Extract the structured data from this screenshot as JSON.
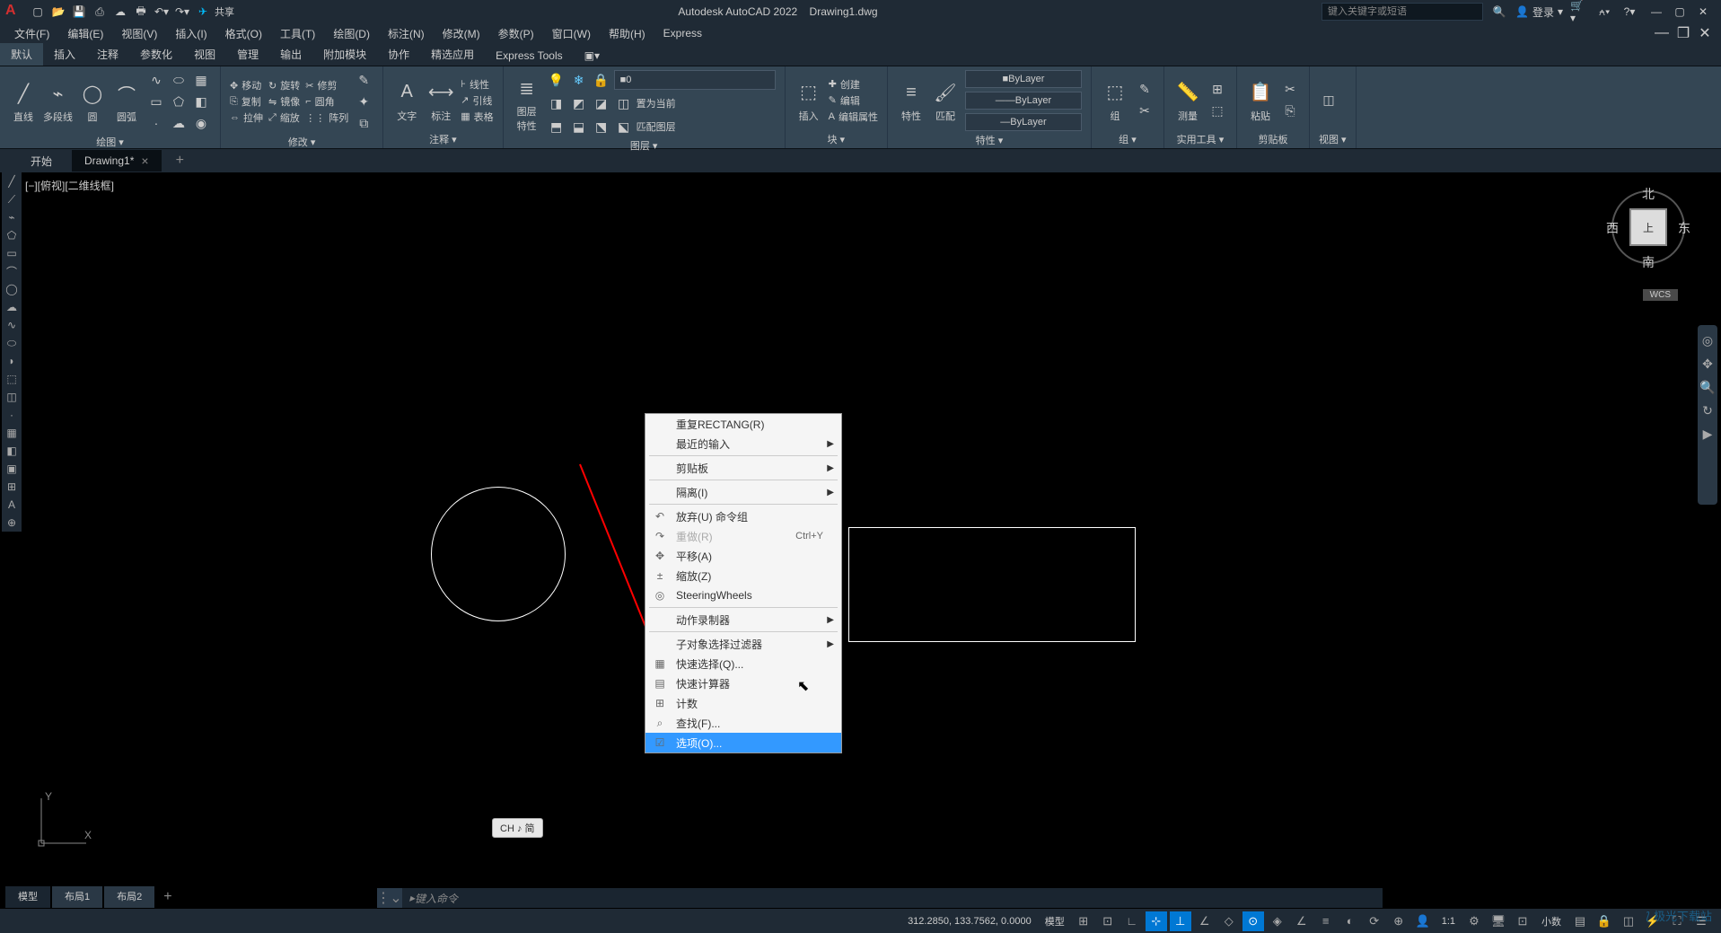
{
  "app": {
    "title_left": "Autodesk AutoCAD 2022",
    "title_right": "Drawing1.dwg",
    "share": "共享",
    "search_placeholder": "键入关键字或短语",
    "login": "登录"
  },
  "menubar": [
    "文件(F)",
    "编辑(E)",
    "视图(V)",
    "插入(I)",
    "格式(O)",
    "工具(T)",
    "绘图(D)",
    "标注(N)",
    "修改(M)",
    "参数(P)",
    "窗口(W)",
    "帮助(H)",
    "Express"
  ],
  "ribbon_tabs": [
    "默认",
    "插入",
    "注释",
    "参数化",
    "视图",
    "管理",
    "输出",
    "附加模块",
    "协作",
    "精选应用",
    "Express Tools"
  ],
  "ribbon": {
    "draw": {
      "label": "绘图 ▾",
      "line": "直线",
      "polyline": "多段线",
      "circle": "圆",
      "arc": "圆弧"
    },
    "modify": {
      "label": "修改 ▾",
      "move": "移动",
      "rotate": "旋转",
      "trim": "修剪",
      "copy": "复制",
      "mirror": "镜像",
      "fillet": "圆角",
      "stretch": "拉伸",
      "scale": "缩放",
      "array": "阵列"
    },
    "annotate": {
      "label": "注释 ▾",
      "text": "文字",
      "dim": "标注",
      "linetype": "线性",
      "leader": "引线",
      "table": "表格"
    },
    "layer": {
      "label": "图层 ▾",
      "props": "图层\n特性",
      "combo": "0",
      "setcurrent": "置为当前",
      "match": "匹配图层"
    },
    "block": {
      "label": "块 ▾",
      "insert": "插入",
      "create": "创建",
      "edit": "编辑",
      "editattr": "编辑属性"
    },
    "props": {
      "label": "特性 ▾",
      "btn": "特性",
      "match": "匹配",
      "bylayer": "ByLayer"
    },
    "group": {
      "label": "组 ▾",
      "btn": "组"
    },
    "util": {
      "label": "实用工具 ▾",
      "measure": "测量"
    },
    "clip": {
      "label": "剪贴板",
      "paste": "粘贴"
    },
    "view": {
      "label": "视图 ▾"
    }
  },
  "file_tabs": {
    "start": "开始",
    "drawing": "Drawing1*"
  },
  "viewport_label": "[−][俯视][二维线框]",
  "viewcube": {
    "n": "北",
    "s": "南",
    "w": "西",
    "e": "东",
    "top": "上",
    "wcs": "WCS"
  },
  "context_menu": [
    {
      "label": "重复RECTANG(R)",
      "type": "item"
    },
    {
      "label": "最近的输入",
      "type": "sub"
    },
    {
      "type": "sep"
    },
    {
      "label": "剪贴板",
      "type": "sub"
    },
    {
      "type": "sep"
    },
    {
      "label": "隔离(I)",
      "type": "sub"
    },
    {
      "type": "sep"
    },
    {
      "label": "放弃(U) 命令组",
      "type": "item",
      "icon": "↶"
    },
    {
      "label": "重做(R)",
      "type": "item",
      "icon": "↷",
      "shortcut": "Ctrl+Y",
      "disabled": true
    },
    {
      "label": "平移(A)",
      "type": "item",
      "icon": "✥"
    },
    {
      "label": "缩放(Z)",
      "type": "item",
      "icon": "±"
    },
    {
      "label": "SteeringWheels",
      "type": "item",
      "icon": "◎"
    },
    {
      "type": "sep"
    },
    {
      "label": "动作录制器",
      "type": "sub"
    },
    {
      "type": "sep"
    },
    {
      "label": "子对象选择过滤器",
      "type": "sub"
    },
    {
      "label": "快速选择(Q)...",
      "type": "item",
      "icon": "▦"
    },
    {
      "label": "快速计算器",
      "type": "item",
      "icon": "▤"
    },
    {
      "label": "计数",
      "type": "item",
      "icon": "⊞"
    },
    {
      "label": "查找(F)...",
      "type": "item",
      "icon": "⌕"
    },
    {
      "label": "选项(O)...",
      "type": "item",
      "icon": "☑",
      "highlighted": true
    }
  ],
  "ime_badge": "CH ♪ 简",
  "cmdline_placeholder": "键入命令",
  "bottom_tabs": {
    "model": "模型",
    "layout1": "布局1",
    "layout2": "布局2"
  },
  "statusbar": {
    "coords": "312.2850, 133.7562, 0.0000",
    "model": "模型",
    "scale": "1:1",
    "decimal": "小数"
  },
  "watermark": "极光下载站"
}
